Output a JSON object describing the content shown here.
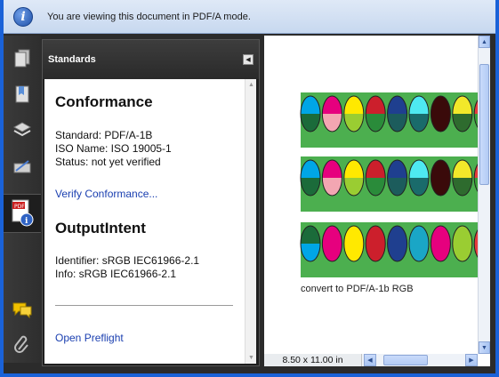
{
  "infobar": {
    "message": "You are viewing this document in PDF/A mode.",
    "icon": "info-icon"
  },
  "sidebar_icons": [
    "pages-icon",
    "bookmarks-icon",
    "layers-icon",
    "signatures-icon",
    "standards-icon",
    "comments-icon",
    "attachments-icon"
  ],
  "panel": {
    "title": "Standards",
    "conformance": {
      "heading": "Conformance",
      "standard": "Standard: PDF/A-1B",
      "iso_name": "ISO Name: ISO 19005-1",
      "status": "Status: not yet verified",
      "verify_link": "Verify Conformance..."
    },
    "output_intent": {
      "heading": "OutputIntent",
      "identifier": "Identifier: sRGB IEC61966-2.1",
      "info": "Info: sRGB IEC61966-2.1"
    },
    "preflight_link": "Open Preflight"
  },
  "document": {
    "caption": "convert to PDF/A-1b RGB",
    "page_size": "8.50 x 11.00 in",
    "swatch_rows": [
      {
        "top": [
          "#00a6e6",
          "#e6007e",
          "#ffe900",
          "#cc1f2c",
          "#1f3f8f",
          "#4ee9f1",
          "#3a0a0a",
          "#f2e82a",
          "#e63c3c"
        ],
        "bottom": [
          "#1b6b3a",
          "#f3a6b2",
          "#9acd32",
          "#2a8b3a",
          "#1c5c5c",
          "#1a6b6b",
          "#3a0a0a",
          "#2e6b2e",
          "#3aa03a"
        ]
      },
      {
        "top": [
          "#00a6e6",
          "#e6007e",
          "#ffe900",
          "#cc1f2c",
          "#1f3f8f",
          "#4ee9f1",
          "#3a0a0a",
          "#f2e82a",
          "#e63c3c"
        ],
        "bottom": [
          "#1b6b3a",
          "#f3a6b2",
          "#9acd32",
          "#2a8b3a",
          "#1c5c5c",
          "#1a6b6b",
          "#3a0a0a",
          "#2e6b2e",
          "#3aa03a"
        ]
      },
      {
        "top": [
          "#1b6b3a",
          "#e6007e",
          "#ffe900",
          "#cc1f2c",
          "#1f3f8f",
          "#1aa6c6",
          "#e6007e",
          "#9acd32",
          "#e63c3c"
        ],
        "bottom": [
          "#00a6e6",
          "#e6007e",
          "#ffe900",
          "#cc1f2c",
          "#1f3f8f",
          "#1aa6c6",
          "#e6007e",
          "#9acd32",
          "#e63c3c"
        ]
      }
    ]
  },
  "colors": {
    "accent": "#1a62d8",
    "panel_bg": "#1f1f1f",
    "link": "#1a3fb0",
    "swatch_green": "#4caf4f"
  }
}
